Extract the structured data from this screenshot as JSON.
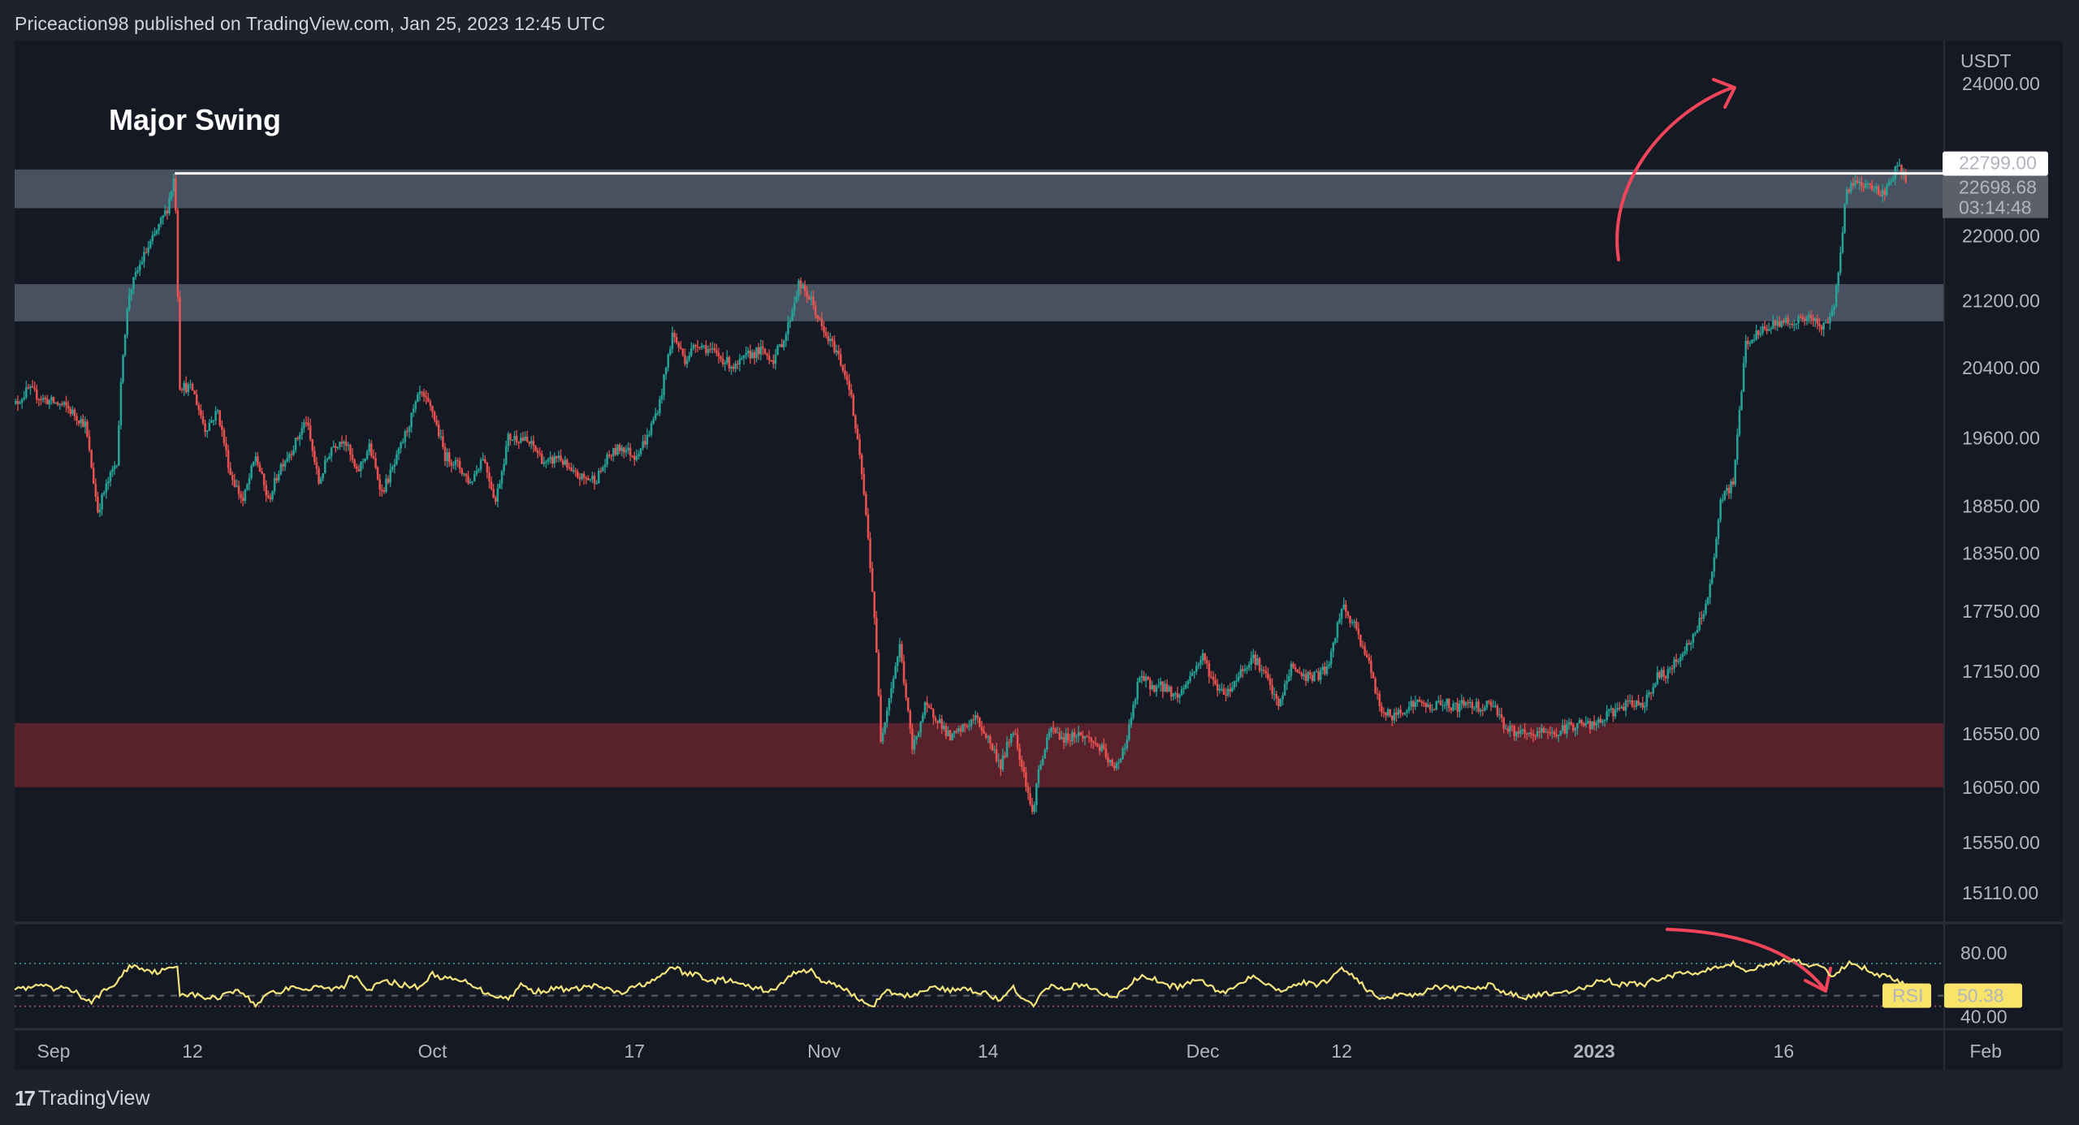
{
  "header": {
    "publisher_line": "Priceaction98 published on TradingView.com, Jan 25, 2023 12:45 UTC"
  },
  "footer": {
    "brand": "TradingView",
    "logo_mark": "17"
  },
  "colors": {
    "background": "#151924",
    "page": "#1e222d",
    "up_candle": "#26a69a",
    "down_candle": "#ef5350",
    "resistance_zone": "#4a5464",
    "support_zone": "#5c222c",
    "rsi_line": "#f3e37c",
    "rsi_badge": "#f7e468",
    "annotation_arrow": "#f2455a",
    "last_price_bg": "#5d606b"
  },
  "chart_data": {
    "type": "candlestick",
    "symbol_currency": "USDT",
    "title": "Major Swing",
    "scale": "log",
    "ylim": [
      14900,
      24300
    ],
    "price_ticks": [
      24000,
      22000,
      21200,
      20400,
      19600,
      18850,
      18350,
      17750,
      17150,
      16550,
      16050,
      15550,
      15110
    ],
    "price_tick_labels": [
      "24000.00",
      "22000.00",
      "21200.00",
      "20400.00",
      "19600.00",
      "18850.00",
      "18350.00",
      "17750.00",
      "17150.00",
      "16550.00",
      "16050.00",
      "15550.00",
      "15110.00"
    ],
    "time_ticks": [
      {
        "label": "Sep",
        "day": 1,
        "bold": false
      },
      {
        "label": "12",
        "day": 12,
        "bold": false
      },
      {
        "label": "Oct",
        "day": 31,
        "bold": false
      },
      {
        "label": "17",
        "day": 47,
        "bold": false
      },
      {
        "label": "Nov",
        "day": 62,
        "bold": false
      },
      {
        "label": "14",
        "day": 75,
        "bold": false
      },
      {
        "label": "Dec",
        "day": 92,
        "bold": false
      },
      {
        "label": "12",
        "day": 103,
        "bold": false
      },
      {
        "label": "2023",
        "day": 123,
        "bold": true
      },
      {
        "label": "16",
        "day": 138,
        "bold": false
      },
      {
        "label": "Feb",
        "day": 154,
        "bold": false
      }
    ],
    "time_range_days": [
      -3.3,
      165
    ],
    "close_anchors_day_price": [
      [
        -2.5,
        19900
      ],
      [
        -1,
        20150
      ],
      [
        0,
        20050
      ],
      [
        2,
        19950
      ],
      [
        3.5,
        19750
      ],
      [
        4.5,
        18800
      ],
      [
        5,
        19000
      ],
      [
        6,
        19350
      ],
      [
        6.5,
        20600
      ],
      [
        7,
        21300
      ],
      [
        8,
        21700
      ],
      [
        9,
        22000
      ],
      [
        10,
        22350
      ],
      [
        10.6,
        22800
      ],
      [
        11,
        20200
      ],
      [
        12,
        20150
      ],
      [
        13,
        19700
      ],
      [
        14,
        19900
      ],
      [
        15,
        19200
      ],
      [
        16,
        18900
      ],
      [
        17,
        19400
      ],
      [
        18,
        18900
      ],
      [
        19,
        19300
      ],
      [
        20,
        19500
      ],
      [
        21,
        19800
      ],
      [
        22,
        19100
      ],
      [
        23,
        19500
      ],
      [
        24,
        19600
      ],
      [
        25,
        19200
      ],
      [
        26,
        19500
      ],
      [
        27,
        19000
      ],
      [
        28,
        19300
      ],
      [
        29,
        19700
      ],
      [
        30,
        20100
      ],
      [
        31,
        19900
      ],
      [
        32,
        19400
      ],
      [
        33,
        19300
      ],
      [
        34,
        19100
      ],
      [
        35,
        19400
      ],
      [
        36,
        18900
      ],
      [
        37,
        19600
      ],
      [
        38,
        19600
      ],
      [
        39,
        19500
      ],
      [
        40,
        19300
      ],
      [
        41,
        19400
      ],
      [
        42,
        19200
      ],
      [
        43,
        19150
      ],
      [
        44,
        19150
      ],
      [
        45,
        19400
      ],
      [
        46,
        19500
      ],
      [
        47,
        19400
      ],
      [
        48,
        19600
      ],
      [
        49,
        20000
      ],
      [
        50,
        20800
      ],
      [
        51,
        20500
      ],
      [
        52,
        20700
      ],
      [
        53,
        20600
      ],
      [
        54,
        20500
      ],
      [
        55,
        20400
      ],
      [
        56,
        20550
      ],
      [
        57,
        20600
      ],
      [
        58,
        20500
      ],
      [
        59,
        20800
      ],
      [
        60,
        21400
      ],
      [
        61,
        21200
      ],
      [
        62,
        20800
      ],
      [
        63,
        20600
      ],
      [
        64,
        20200
      ],
      [
        65,
        19200
      ],
      [
        65.5,
        18500
      ],
      [
        66,
        17700
      ],
      [
        66.5,
        16500
      ],
      [
        67,
        16800
      ],
      [
        68,
        17400
      ],
      [
        69,
        16400
      ],
      [
        70,
        16800
      ],
      [
        71,
        16700
      ],
      [
        72,
        16500
      ],
      [
        73,
        16600
      ],
      [
        74,
        16700
      ],
      [
        75,
        16500
      ],
      [
        76,
        16250
      ],
      [
        77,
        16600
      ],
      [
        78,
        16100
      ],
      [
        78.5,
        15800
      ],
      [
        79,
        16200
      ],
      [
        80,
        16600
      ],
      [
        81,
        16500
      ],
      [
        82,
        16550
      ],
      [
        83,
        16500
      ],
      [
        84,
        16400
      ],
      [
        85,
        16200
      ],
      [
        86,
        16500
      ],
      [
        87,
        17100
      ],
      [
        88,
        17000
      ],
      [
        89,
        17000
      ],
      [
        90,
        16900
      ],
      [
        91,
        17100
      ],
      [
        92,
        17300
      ],
      [
        93,
        17000
      ],
      [
        94,
        16950
      ],
      [
        95,
        17150
      ],
      [
        96,
        17300
      ],
      [
        97,
        17100
      ],
      [
        98,
        16800
      ],
      [
        99,
        17200
      ],
      [
        100,
        17100
      ],
      [
        101,
        17100
      ],
      [
        102,
        17200
      ],
      [
        103,
        17800
      ],
      [
        104,
        17600
      ],
      [
        105,
        17300
      ],
      [
        106,
        16800
      ],
      [
        107,
        16700
      ],
      [
        108,
        16800
      ],
      [
        109,
        16850
      ],
      [
        110,
        16800
      ],
      [
        111,
        16850
      ],
      [
        112,
        16800
      ],
      [
        113,
        16850
      ],
      [
        114,
        16800
      ],
      [
        115,
        16850
      ],
      [
        116,
        16600
      ],
      [
        117,
        16550
      ],
      [
        118,
        16520
      ],
      [
        119,
        16580
      ],
      [
        120,
        16550
      ],
      [
        121,
        16620
      ],
      [
        122,
        16650
      ],
      [
        123,
        16620
      ],
      [
        124,
        16720
      ],
      [
        125,
        16800
      ],
      [
        126,
        16830
      ],
      [
        127,
        16850
      ],
      [
        128,
        17100
      ],
      [
        129,
        17150
      ],
      [
        130,
        17350
      ],
      [
        131,
        17500
      ],
      [
        132,
        17900
      ],
      [
        132.5,
        18250
      ],
      [
        133,
        18900
      ],
      [
        134,
        19100
      ],
      [
        135,
        20700
      ],
      [
        136,
        20800
      ],
      [
        137,
        20900
      ],
      [
        138,
        20950
      ],
      [
        139,
        20950
      ],
      [
        140,
        21000
      ],
      [
        141,
        20850
      ],
      [
        142,
        21100
      ],
      [
        143,
        22600
      ],
      [
        144,
        22700
      ],
      [
        145,
        22600
      ],
      [
        146,
        22550
      ],
      [
        147,
        22900
      ],
      [
        147.8,
        22700
      ]
    ],
    "zones": [
      {
        "name": "upper-resistance",
        "from": 22350,
        "to": 22850
      },
      {
        "name": "mid-resistance",
        "from": 20950,
        "to": 21400
      },
      {
        "name": "support",
        "from": 16050,
        "to": 16650
      }
    ],
    "swing_high_line": {
      "price": 22799,
      "from_day": 10.6
    },
    "last_price_label": "22799.00",
    "current_price_label": "22698.68",
    "countdown_label": "03:14:48",
    "rsi": {
      "label": "RSI",
      "value_label": "50.38",
      "ylim": [
        30,
        90
      ],
      "upper_band": 70,
      "middle_band": 50,
      "lower_band": 30,
      "axis_labels": [
        "80.00",
        "40.00"
      ],
      "anchors_day_value": [
        [
          -3,
          38
        ],
        [
          -2.5,
          36
        ],
        [
          -2,
          48
        ],
        [
          -1,
          46
        ],
        [
          0,
          50
        ],
        [
          1,
          45
        ],
        [
          2,
          48
        ],
        [
          3,
          42
        ],
        [
          3.5,
          33
        ],
        [
          4,
          35
        ],
        [
          5,
          44
        ],
        [
          6,
          52
        ],
        [
          7,
          68
        ],
        [
          8,
          66
        ],
        [
          9,
          62
        ],
        [
          10,
          64
        ],
        [
          10.8,
          68
        ],
        [
          11,
          42
        ],
        [
          12,
          41
        ],
        [
          13,
          38
        ],
        [
          14,
          38
        ],
        [
          15,
          45
        ],
        [
          16,
          43
        ],
        [
          17,
          30
        ],
        [
          18,
          44
        ],
        [
          19,
          43
        ],
        [
          20,
          50
        ],
        [
          21,
          45
        ],
        [
          22,
          48
        ],
        [
          23,
          46
        ],
        [
          24,
          48
        ],
        [
          24.5,
          60
        ],
        [
          25,
          58
        ],
        [
          26,
          45
        ],
        [
          27,
          53
        ],
        [
          28,
          52
        ],
        [
          29,
          49
        ],
        [
          30,
          48
        ],
        [
          31,
          60
        ],
        [
          32,
          56
        ],
        [
          33,
          54
        ],
        [
          34,
          52
        ],
        [
          35,
          44
        ],
        [
          36,
          40
        ],
        [
          37,
          37
        ],
        [
          38,
          50
        ],
        [
          39,
          44
        ],
        [
          40,
          45
        ],
        [
          41,
          47
        ],
        [
          42,
          45
        ],
        [
          43,
          48
        ],
        [
          44,
          49
        ],
        [
          45,
          45
        ],
        [
          46,
          42
        ],
        [
          47,
          48
        ],
        [
          48,
          52
        ],
        [
          49,
          56
        ],
        [
          50,
          68
        ],
        [
          51,
          60
        ],
        [
          52,
          60
        ],
        [
          53,
          53
        ],
        [
          54,
          55
        ],
        [
          55,
          52
        ],
        [
          56,
          48
        ],
        [
          57,
          46
        ],
        [
          58,
          44
        ],
        [
          59,
          55
        ],
        [
          60,
          64
        ],
        [
          61,
          63
        ],
        [
          62,
          52
        ],
        [
          63,
          50
        ],
        [
          64,
          44
        ],
        [
          65,
          34
        ],
        [
          66,
          32
        ],
        [
          67,
          44
        ],
        [
          68,
          40
        ],
        [
          69,
          40
        ],
        [
          70,
          46
        ],
        [
          71,
          48
        ],
        [
          72,
          44
        ],
        [
          73,
          48
        ],
        [
          74,
          44
        ],
        [
          75,
          42
        ],
        [
          76,
          34
        ],
        [
          77,
          48
        ],
        [
          78,
          34
        ],
        [
          78.5,
          30
        ],
        [
          79,
          40
        ],
        [
          80,
          48
        ],
        [
          81,
          46
        ],
        [
          82,
          50
        ],
        [
          83,
          48
        ],
        [
          84,
          42
        ],
        [
          85,
          38
        ],
        [
          86,
          48
        ],
        [
          87,
          58
        ],
        [
          88,
          56
        ],
        [
          89,
          50
        ],
        [
          90,
          48
        ],
        [
          91,
          52
        ],
        [
          92,
          54
        ],
        [
          93,
          46
        ],
        [
          94,
          44
        ],
        [
          95,
          52
        ],
        [
          96,
          60
        ],
        [
          97,
          52
        ],
        [
          98,
          44
        ],
        [
          99,
          50
        ],
        [
          100,
          52
        ],
        [
          101,
          50
        ],
        [
          102,
          55
        ],
        [
          103,
          66
        ],
        [
          104,
          58
        ],
        [
          105,
          45
        ],
        [
          106,
          38
        ],
        [
          107,
          40
        ],
        [
          108,
          42
        ],
        [
          109,
          40
        ],
        [
          110,
          48
        ],
        [
          111,
          48
        ],
        [
          112,
          46
        ],
        [
          113,
          47
        ],
        [
          114,
          48
        ],
        [
          115,
          50
        ],
        [
          116,
          42
        ],
        [
          117,
          40
        ],
        [
          118,
          38
        ],
        [
          119,
          42
        ],
        [
          120,
          40
        ],
        [
          121,
          44
        ],
        [
          122,
          46
        ],
        [
          123,
          52
        ],
        [
          124,
          55
        ],
        [
          125,
          50
        ],
        [
          126,
          52
        ],
        [
          127,
          50
        ],
        [
          128,
          56
        ],
        [
          129,
          58
        ],
        [
          130,
          62
        ],
        [
          131,
          60
        ],
        [
          132,
          66
        ],
        [
          133,
          68
        ],
        [
          134,
          70
        ],
        [
          135,
          63
        ],
        [
          136,
          66
        ],
        [
          137,
          70
        ],
        [
          138,
          72
        ],
        [
          139,
          74
        ],
        [
          140,
          68
        ],
        [
          141,
          66
        ],
        [
          142,
          58
        ],
        [
          143,
          70
        ],
        [
          144,
          68
        ],
        [
          145,
          62
        ],
        [
          146,
          58
        ],
        [
          147,
          54
        ],
        [
          147.5,
          50
        ],
        [
          148,
          50.38
        ]
      ]
    },
    "annotations": [
      {
        "type": "text",
        "text": "Major Swing"
      },
      {
        "type": "arrow",
        "direction": "up-right",
        "pane": "price"
      },
      {
        "type": "arrow",
        "direction": "down-right",
        "pane": "rsi"
      }
    ]
  }
}
